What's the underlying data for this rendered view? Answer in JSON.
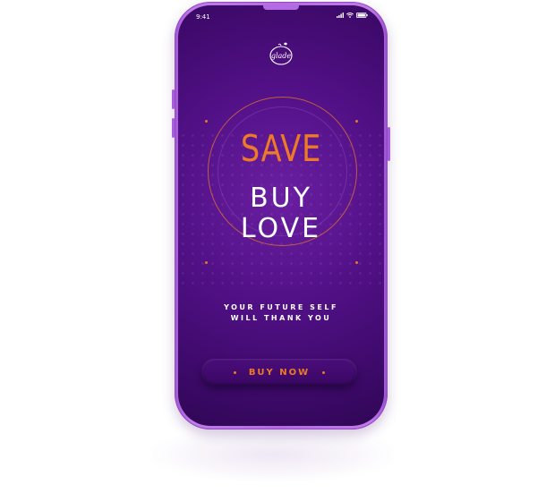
{
  "status_bar": {
    "time": "9:41",
    "icons": [
      "signal-icon",
      "wifi-icon",
      "battery-icon"
    ]
  },
  "brand": {
    "logo_text": "glade"
  },
  "headline": {
    "line1": "SAVE",
    "line2": "BUY",
    "line3": "LOVE"
  },
  "tagline": {
    "line1": "YOUR FUTURE SELF",
    "line2": "WILL THANK YOU"
  },
  "cta": {
    "label": "BUY NOW"
  },
  "colors": {
    "accent": "#ee7a28",
    "background": "#531188",
    "frame": "#b56be0",
    "text": "#ffffff"
  }
}
